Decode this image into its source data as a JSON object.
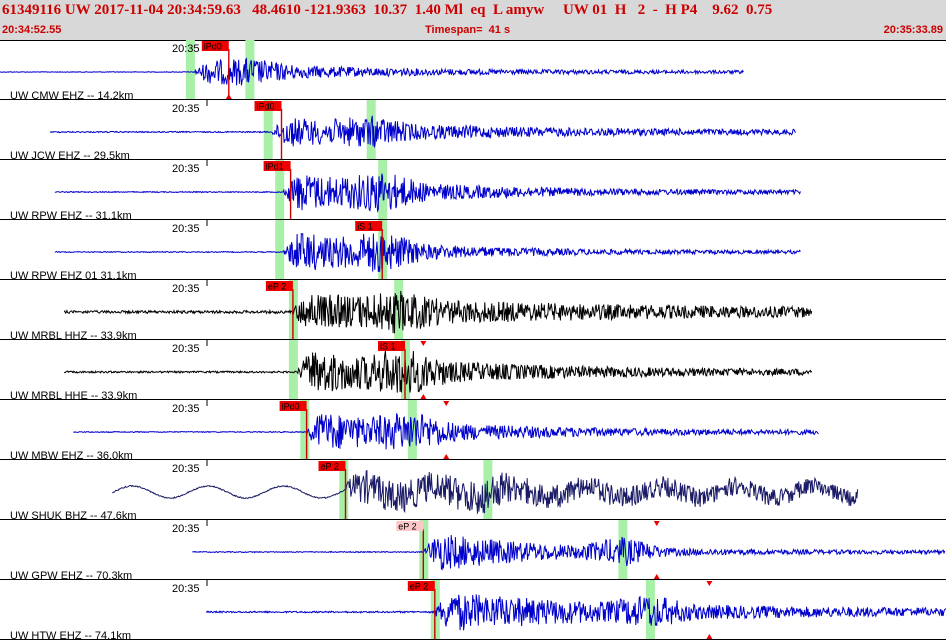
{
  "header": {
    "event_line": "61349116 UW 2017-11-04 20:34:59.63   48.4610 -121.9363  10.37  1.40 Ml  eq  L amyw     UW 01  H   2  -  H P4    9.62  0.75",
    "start_time": "20:34:52.55",
    "timespan": "Timespan=  41 s",
    "end_time": "20:35:33.89"
  },
  "colors": {
    "header_bg": "#d8d8d8",
    "header_text": "#cc0000",
    "trace_blue": "#0000cc",
    "trace_black": "#000000",
    "trace_navy": "#1a1a66",
    "pick_red": "#ee0000",
    "pick_pink": "#ffc8c8",
    "pick_line": "#cc0000",
    "window_green": "#a8f0a8"
  },
  "icons": [
    "pick-triangle-icon"
  ],
  "channels": [
    {
      "minute_label": "20:35",
      "station_label": "UW CMW EHZ -- 14.2km",
      "color": "blue",
      "picks": [
        {
          "label": "iPd0",
          "t": 10.0,
          "style": "red"
        }
      ],
      "amp_triangles": [],
      "windows": [
        8.3,
        10.9
      ]
    },
    {
      "minute_label": "20:35",
      "station_label": "UW JCW EHZ -- 29.5km",
      "color": "blue",
      "picks": [
        {
          "label": "iPd0",
          "t": 12.3,
          "style": "red"
        }
      ],
      "amp_triangles": [],
      "windows": [
        11.7,
        16.2
      ]
    },
    {
      "minute_label": "20:35",
      "station_label": "UW RPW EHZ -- 31.1km",
      "color": "blue",
      "picks": [
        {
          "label": "iPd1",
          "t": 12.7,
          "style": "red"
        }
      ],
      "amp_triangles": [],
      "windows": [
        12.2,
        16.7
      ]
    },
    {
      "minute_label": "20:35",
      "station_label": "UW RPW EHZ 01 31.1km",
      "color": "blue",
      "picks": [
        {
          "label": "iS 1",
          "t": 16.7,
          "style": "red"
        }
      ],
      "amp_triangles": [],
      "windows": [
        12.2,
        16.7
      ]
    },
    {
      "minute_label": "20:35",
      "station_label": "UW MRBL HHZ -- 33.9km",
      "color": "black",
      "picks": [
        {
          "label": "eP 2",
          "t": 12.8,
          "style": "red"
        }
      ],
      "amp_triangles": [],
      "windows": [
        12.8,
        17.4
      ]
    },
    {
      "minute_label": "20:35",
      "station_label": "UW MRBL HHE -- 33.9km",
      "color": "black",
      "picks": [
        {
          "label": "iS 1",
          "t": 17.7,
          "style": "red"
        }
      ],
      "amp_triangles": [
        18.5
      ],
      "windows": [
        12.8,
        17.7
      ]
    },
    {
      "minute_label": "20:35",
      "station_label": "UW MBW EHZ -- 36.0km",
      "color": "blue",
      "picks": [
        {
          "label": "iPd0",
          "t": 13.4,
          "style": "red"
        }
      ],
      "amp_triangles": [
        19.5
      ],
      "windows": [
        13.3,
        18.0
      ]
    },
    {
      "minute_label": "20:35",
      "station_label": "UW SHUK BHZ -- 47.6km",
      "color": "navy",
      "picks": [
        {
          "label": "eP 2",
          "t": 15.1,
          "style": "red"
        }
      ],
      "amp_triangles": [],
      "windows": [
        15.0,
        21.3
      ]
    },
    {
      "minute_label": "20:35",
      "station_label": "UW GPW EHZ -- 70.3km",
      "color": "blue",
      "picks": [
        {
          "label": "eP 2",
          "t": 18.5,
          "style": "pink"
        }
      ],
      "amp_triangles": [
        28.7
      ],
      "windows": [
        18.5,
        27.2
      ]
    },
    {
      "minute_label": "20:35",
      "station_label": "UW HTW EHZ -- 74.1km",
      "color": "blue",
      "picks": [
        {
          "label": "eP 2",
          "t": 19.0,
          "style": "red"
        }
      ],
      "amp_triangles": [
        31.0
      ],
      "windows": [
        19.0,
        28.4
      ]
    }
  ]
}
